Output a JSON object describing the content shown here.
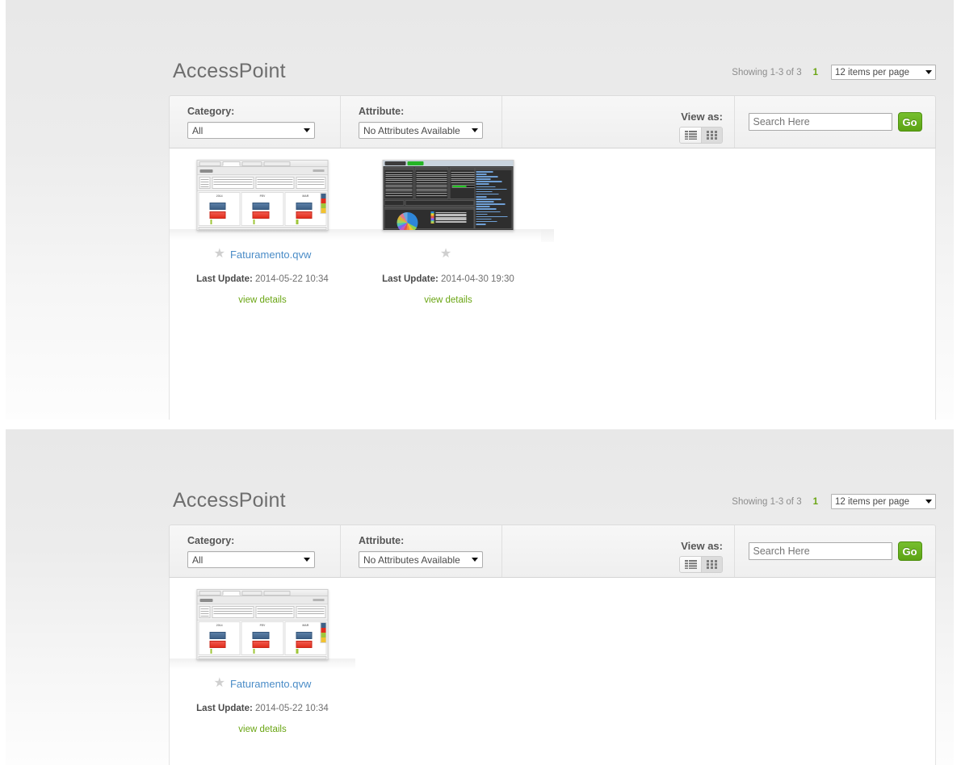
{
  "app": {
    "title": "AccessPoint"
  },
  "paging": {
    "showing": "Showing 1-3 of 3",
    "current_page": "1",
    "per_page": "12 items per page",
    "per_page_options": [
      "12 items per page"
    ]
  },
  "filters": {
    "category_label": "Category:",
    "category_value": "All",
    "category_options": [
      "All"
    ],
    "attribute_label": "Attribute:",
    "attribute_value": "No Attributes Available",
    "attribute_options": [
      "No Attributes Available"
    ],
    "view_as_label": "View as:",
    "view_list_icon": "list-view-icon",
    "view_grid_icon": "grid-view-icon",
    "active_view": "grid"
  },
  "search": {
    "value": "",
    "placeholder": "Search Here",
    "go_label": "Go"
  },
  "labels": {
    "last_update_label": "Last Update:",
    "view_details": "view details",
    "star_icon": "star-icon"
  },
  "documents": [
    {
      "name": "Faturamento.qvw",
      "last_update": "2014-05-22 10:34",
      "view_details": "view details",
      "thumbnail": "qlikview-light-billing-dashboard",
      "has_name_link": true
    },
    {
      "name": "",
      "last_update": "2014-04-30 19:30",
      "view_details": "view details",
      "thumbnail": "qlikview-dark-pie-dashboard",
      "has_name_link": false
    }
  ],
  "panel2": {
    "documents": [
      {
        "name": "Faturamento.qvw",
        "last_update": "2014-05-22 10:34",
        "view_details": "view details",
        "thumbnail": "qlikview-light-billing-dashboard",
        "has_name_link": true
      }
    ]
  },
  "colors": {
    "accent_green": "#6aa513",
    "link_blue": "#4a8cc7",
    "go_button": "#5ca314",
    "star_gray": "#cfcfcf"
  }
}
